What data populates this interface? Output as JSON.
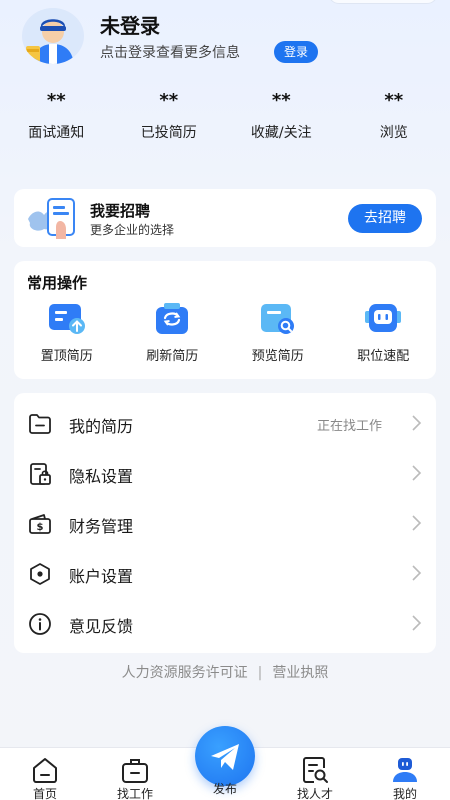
{
  "profile": {
    "username": "未登录",
    "hint": "点击登录查看更多信息",
    "login_label": "登录"
  },
  "stats": [
    {
      "value": "**",
      "label": "面试通知"
    },
    {
      "value": "**",
      "label": "已投简历"
    },
    {
      "value": "**",
      "label": "收藏/关注"
    },
    {
      "value": "**",
      "label": "浏览"
    }
  ],
  "recruit": {
    "title": "我要招聘",
    "subtitle": "更多企业的选择",
    "button_label": "去招聘"
  },
  "ops": {
    "title": "常用操作",
    "items": [
      {
        "label": "置顶简历",
        "icon": "pin-resume-icon"
      },
      {
        "label": "刷新简历",
        "icon": "refresh-resume-icon"
      },
      {
        "label": "预览简历",
        "icon": "preview-resume-icon"
      },
      {
        "label": "职位速配",
        "icon": "job-match-icon"
      }
    ]
  },
  "menu": [
    {
      "label": "我的简历",
      "value": "正在找工作",
      "icon": "folder-icon"
    },
    {
      "label": "隐私设置",
      "value": "",
      "icon": "privacy-lock-icon"
    },
    {
      "label": "财务管理",
      "value": "",
      "icon": "wallet-icon"
    },
    {
      "label": "账户设置",
      "value": "",
      "icon": "hexagon-settings-icon"
    },
    {
      "label": "意见反馈",
      "value": "",
      "icon": "info-icon"
    }
  ],
  "footer": {
    "license": "人力资源服务许可证",
    "separator": "|",
    "business": "营业执照"
  },
  "tabbar": [
    {
      "label": "首页",
      "icon": "home-icon"
    },
    {
      "label": "找工作",
      "icon": "briefcase-icon"
    },
    {
      "label": "发布",
      "icon": "paper-plane-icon"
    },
    {
      "label": "找人才",
      "icon": "talent-search-icon"
    },
    {
      "label": "我的",
      "icon": "profile-icon"
    }
  ],
  "colors": {
    "accent": "#1e74f0",
    "icon_blue": "#2f7cf6",
    "icon_light": "#5bb8f5"
  }
}
